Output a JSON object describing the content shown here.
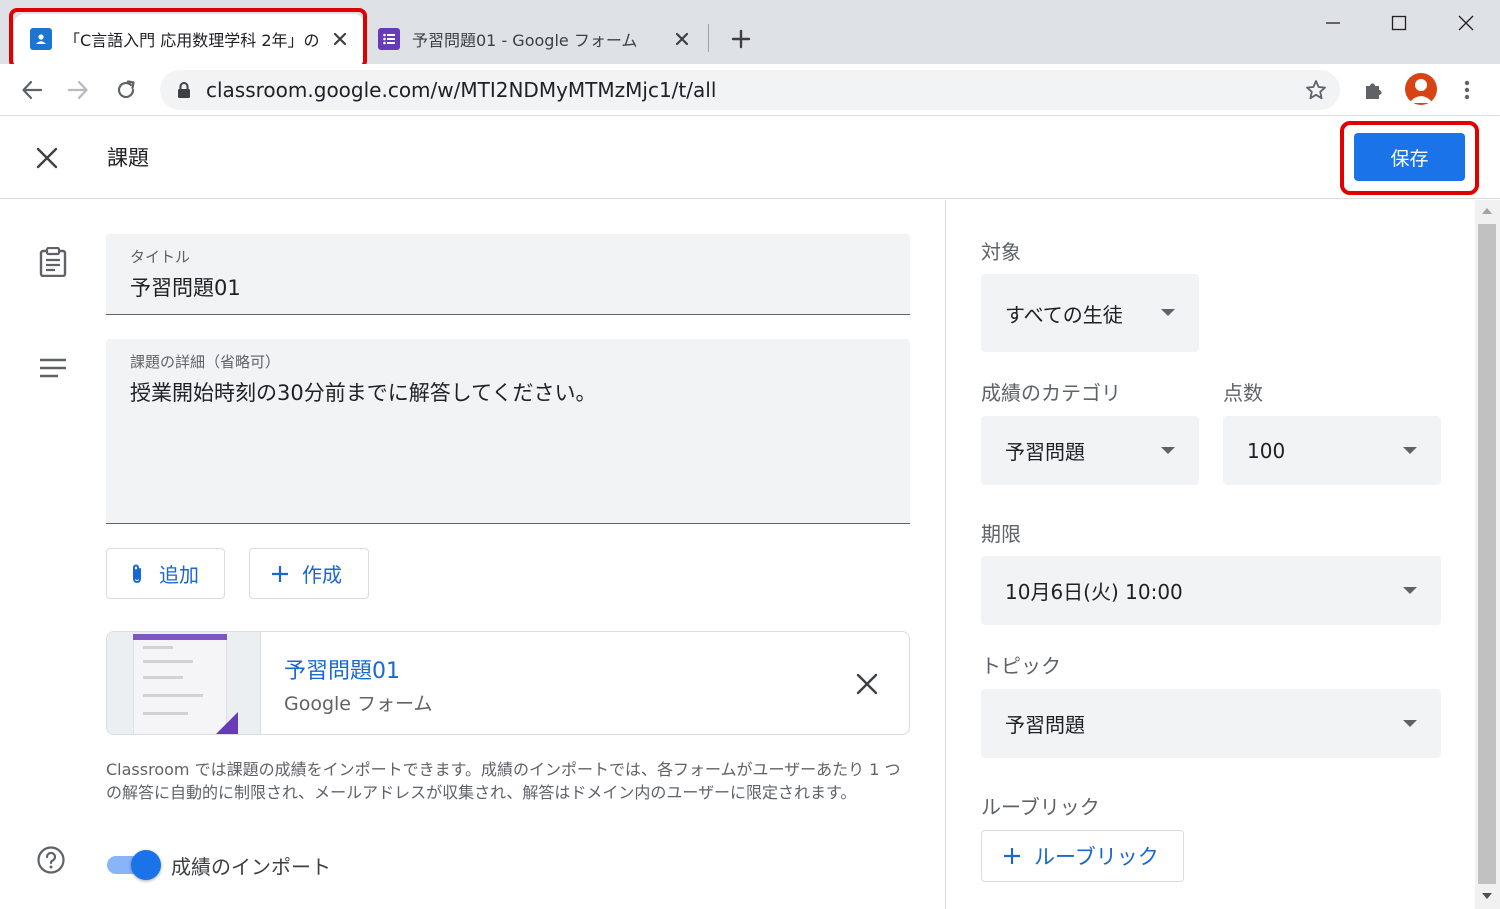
{
  "browser": {
    "tabs": [
      {
        "title": "「C言語入門 応用数理学科 2年」の",
        "active": true,
        "favicon": "classroom-icon"
      },
      {
        "title": "予習問題01 - Google フォーム",
        "active": false,
        "favicon": "forms-icon"
      }
    ],
    "url": "classroom.google.com/w/MTI2NDMyMTMzMjc1/t/all"
  },
  "header": {
    "title": "課題",
    "save_label": "保存"
  },
  "form": {
    "title_label": "タイトル",
    "title_value": "予習問題01",
    "details_label": "課題の詳細（省略可）",
    "details_value": "授業開始時刻の30分前までに解答してください。",
    "add_label": "追加",
    "create_label": "作成",
    "attachment": {
      "title": "予習問題01",
      "type": "Google フォーム"
    },
    "info_text": "Classroom では課題の成績をインポートできます。成績のインポートでは、各フォームがユーザーあたり 1 つの解答に自動的に制限され、メールアドレスが収集され、解答はドメイン内のユーザーに限定されます。",
    "import_grades_label": "成績のインポート",
    "import_grades_on": true
  },
  "sidebar": {
    "target_label": "対象",
    "target_value": "すべての生徒",
    "category_label": "成績のカテゴリ",
    "category_value": "予習問題",
    "points_label": "点数",
    "points_value": "100",
    "due_label": "期限",
    "due_value": "10月6日(火) 10:00",
    "topic_label": "トピック",
    "topic_value": "予習問題",
    "rubric_label": "ルーブリック",
    "rubric_button": "ルーブリック"
  },
  "colors": {
    "accent": "#1a73e8",
    "highlight": "#e00000"
  }
}
